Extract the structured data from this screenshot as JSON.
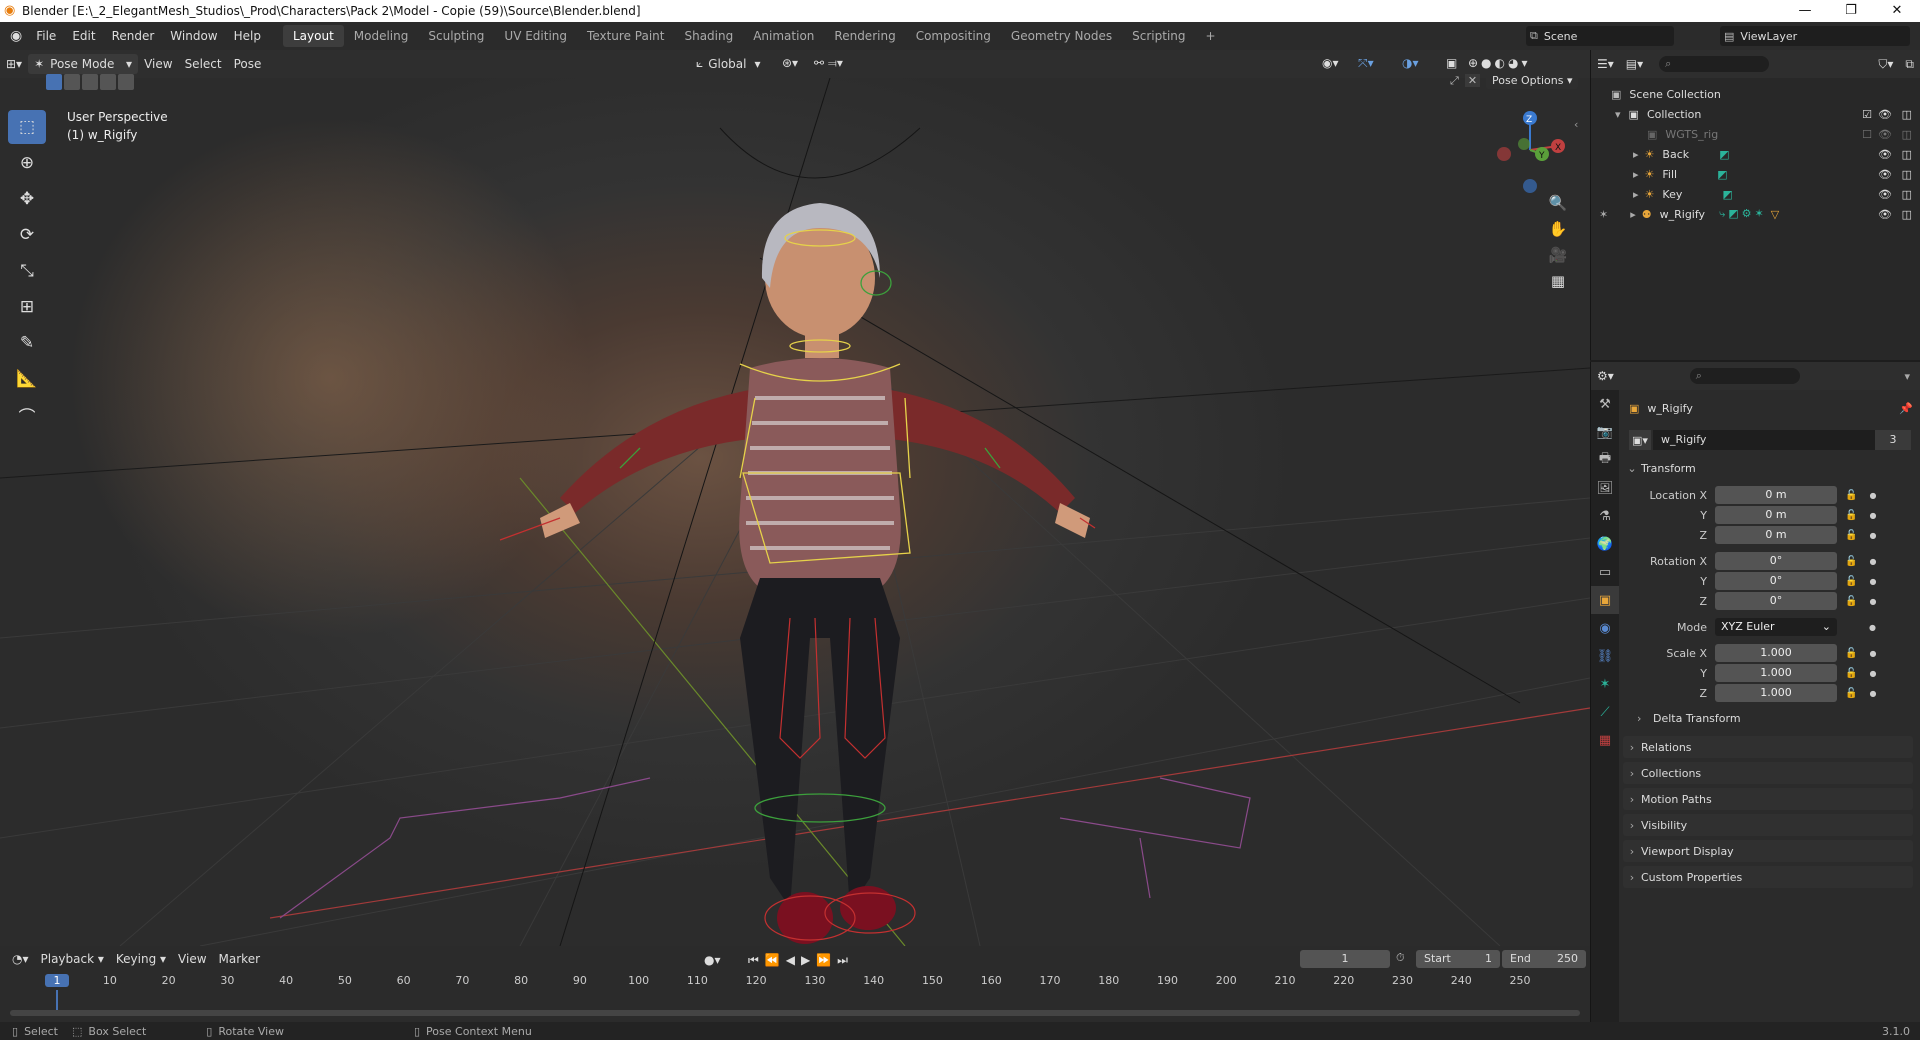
{
  "title_bar": {
    "title": "Blender [E:\\_2_ElegantMesh_Studios\\_Prod\\Characters\\Pack 2\\Model - Copie (59)\\Source\\Blender.blend]",
    "minimize": "—",
    "maximize": "❐",
    "close": "✕"
  },
  "menu": [
    "File",
    "Edit",
    "Render",
    "Window",
    "Help"
  ],
  "workspaces": [
    "Layout",
    "Modeling",
    "Sculpting",
    "UV Editing",
    "Texture Paint",
    "Shading",
    "Animation",
    "Rendering",
    "Compositing",
    "Geometry Nodes",
    "Scripting"
  ],
  "workspace_add": "+",
  "scene": {
    "label": "Scene"
  },
  "view_layer": {
    "label": "ViewLayer"
  },
  "viewport_header": {
    "mode": "Pose Mode",
    "menus": [
      "View",
      "Select",
      "Pose"
    ],
    "transform_orientation": "Global",
    "pose_options": "Pose Options"
  },
  "viewport": {
    "perspective": "User Perspective",
    "object": "(1) w_Rigify",
    "gizmo": {
      "x": "X",
      "y": "Y",
      "z": "Z"
    }
  },
  "outliner": {
    "root": "Scene Collection",
    "collection": "Collection",
    "items": [
      "WGTS_rig",
      "Back",
      "Fill",
      "Key",
      "w_Rigify"
    ]
  },
  "properties": {
    "object_name": "w_Rigify",
    "data_name": "w_Rigify",
    "users": "3",
    "transform_header": "Transform",
    "location_label": "Location X",
    "rotation_label": "Rotation X",
    "scale_label": "Scale X",
    "y_label": "Y",
    "z_label": "Z",
    "location": [
      "0 m",
      "0 m",
      "0 m"
    ],
    "rotation": [
      "0°",
      "0°",
      "0°"
    ],
    "mode_label": "Mode",
    "mode": "XYZ Euler",
    "scale": [
      "1.000",
      "1.000",
      "1.000"
    ],
    "delta": "Delta Transform",
    "panels": [
      "Relations",
      "Collections",
      "Motion Paths",
      "Visibility",
      "Viewport Display",
      "Custom Properties"
    ]
  },
  "timeline": {
    "menus": [
      "Playback",
      "Keying",
      "View",
      "Marker"
    ],
    "current_frame": "1",
    "start_label": "Start",
    "start": "1",
    "end_label": "End",
    "end": "250",
    "ticks": [
      "1",
      "10",
      "20",
      "30",
      "40",
      "50",
      "60",
      "70",
      "80",
      "90",
      "100",
      "110",
      "120",
      "130",
      "140",
      "150",
      "160",
      "170",
      "180",
      "190",
      "200",
      "210",
      "220",
      "230",
      "240",
      "250"
    ]
  },
  "statusbar": {
    "select": "Select",
    "box_select": "Box Select",
    "rotate": "Rotate View",
    "context": "Pose Context Menu",
    "version": "3.1.0"
  }
}
